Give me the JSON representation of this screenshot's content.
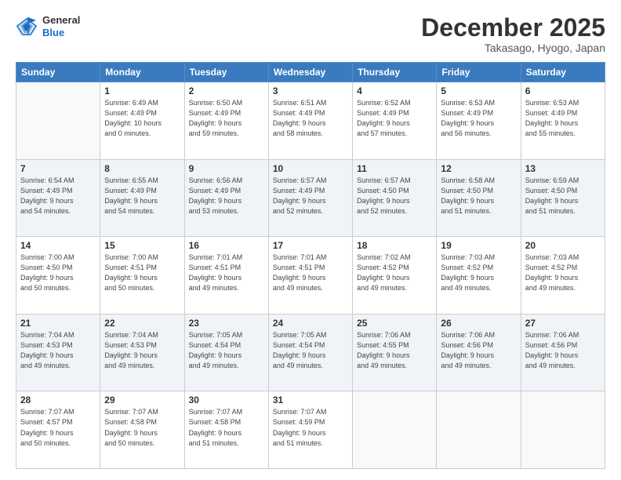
{
  "logo": {
    "line1": "General",
    "line2": "Blue"
  },
  "title": "December 2025",
  "location": "Takasago, Hyogo, Japan",
  "days_header": [
    "Sunday",
    "Monday",
    "Tuesday",
    "Wednesday",
    "Thursday",
    "Friday",
    "Saturday"
  ],
  "weeks": [
    [
      {
        "num": "",
        "info": ""
      },
      {
        "num": "1",
        "info": "Sunrise: 6:49 AM\nSunset: 4:49 PM\nDaylight: 10 hours\nand 0 minutes."
      },
      {
        "num": "2",
        "info": "Sunrise: 6:50 AM\nSunset: 4:49 PM\nDaylight: 9 hours\nand 59 minutes."
      },
      {
        "num": "3",
        "info": "Sunrise: 6:51 AM\nSunset: 4:49 PM\nDaylight: 9 hours\nand 58 minutes."
      },
      {
        "num": "4",
        "info": "Sunrise: 6:52 AM\nSunset: 4:49 PM\nDaylight: 9 hours\nand 57 minutes."
      },
      {
        "num": "5",
        "info": "Sunrise: 6:53 AM\nSunset: 4:49 PM\nDaylight: 9 hours\nand 56 minutes."
      },
      {
        "num": "6",
        "info": "Sunrise: 6:53 AM\nSunset: 4:49 PM\nDaylight: 9 hours\nand 55 minutes."
      }
    ],
    [
      {
        "num": "7",
        "info": "Sunrise: 6:54 AM\nSunset: 4:49 PM\nDaylight: 9 hours\nand 54 minutes."
      },
      {
        "num": "8",
        "info": "Sunrise: 6:55 AM\nSunset: 4:49 PM\nDaylight: 9 hours\nand 54 minutes."
      },
      {
        "num": "9",
        "info": "Sunrise: 6:56 AM\nSunset: 4:49 PM\nDaylight: 9 hours\nand 53 minutes."
      },
      {
        "num": "10",
        "info": "Sunrise: 6:57 AM\nSunset: 4:49 PM\nDaylight: 9 hours\nand 52 minutes."
      },
      {
        "num": "11",
        "info": "Sunrise: 6:57 AM\nSunset: 4:50 PM\nDaylight: 9 hours\nand 52 minutes."
      },
      {
        "num": "12",
        "info": "Sunrise: 6:58 AM\nSunset: 4:50 PM\nDaylight: 9 hours\nand 51 minutes."
      },
      {
        "num": "13",
        "info": "Sunrise: 6:59 AM\nSunset: 4:50 PM\nDaylight: 9 hours\nand 51 minutes."
      }
    ],
    [
      {
        "num": "14",
        "info": "Sunrise: 7:00 AM\nSunset: 4:50 PM\nDaylight: 9 hours\nand 50 minutes."
      },
      {
        "num": "15",
        "info": "Sunrise: 7:00 AM\nSunset: 4:51 PM\nDaylight: 9 hours\nand 50 minutes."
      },
      {
        "num": "16",
        "info": "Sunrise: 7:01 AM\nSunset: 4:51 PM\nDaylight: 9 hours\nand 49 minutes."
      },
      {
        "num": "17",
        "info": "Sunrise: 7:01 AM\nSunset: 4:51 PM\nDaylight: 9 hours\nand 49 minutes."
      },
      {
        "num": "18",
        "info": "Sunrise: 7:02 AM\nSunset: 4:52 PM\nDaylight: 9 hours\nand 49 minutes."
      },
      {
        "num": "19",
        "info": "Sunrise: 7:03 AM\nSunset: 4:52 PM\nDaylight: 9 hours\nand 49 minutes."
      },
      {
        "num": "20",
        "info": "Sunrise: 7:03 AM\nSunset: 4:52 PM\nDaylight: 9 hours\nand 49 minutes."
      }
    ],
    [
      {
        "num": "21",
        "info": "Sunrise: 7:04 AM\nSunset: 4:53 PM\nDaylight: 9 hours\nand 49 minutes."
      },
      {
        "num": "22",
        "info": "Sunrise: 7:04 AM\nSunset: 4:53 PM\nDaylight: 9 hours\nand 49 minutes."
      },
      {
        "num": "23",
        "info": "Sunrise: 7:05 AM\nSunset: 4:54 PM\nDaylight: 9 hours\nand 49 minutes."
      },
      {
        "num": "24",
        "info": "Sunrise: 7:05 AM\nSunset: 4:54 PM\nDaylight: 9 hours\nand 49 minutes."
      },
      {
        "num": "25",
        "info": "Sunrise: 7:06 AM\nSunset: 4:55 PM\nDaylight: 9 hours\nand 49 minutes."
      },
      {
        "num": "26",
        "info": "Sunrise: 7:06 AM\nSunset: 4:56 PM\nDaylight: 9 hours\nand 49 minutes."
      },
      {
        "num": "27",
        "info": "Sunrise: 7:06 AM\nSunset: 4:56 PM\nDaylight: 9 hours\nand 49 minutes."
      }
    ],
    [
      {
        "num": "28",
        "info": "Sunrise: 7:07 AM\nSunset: 4:57 PM\nDaylight: 9 hours\nand 50 minutes."
      },
      {
        "num": "29",
        "info": "Sunrise: 7:07 AM\nSunset: 4:58 PM\nDaylight: 9 hours\nand 50 minutes."
      },
      {
        "num": "30",
        "info": "Sunrise: 7:07 AM\nSunset: 4:58 PM\nDaylight: 9 hours\nand 51 minutes."
      },
      {
        "num": "31",
        "info": "Sunrise: 7:07 AM\nSunset: 4:59 PM\nDaylight: 9 hours\nand 51 minutes."
      },
      {
        "num": "",
        "info": ""
      },
      {
        "num": "",
        "info": ""
      },
      {
        "num": "",
        "info": ""
      }
    ]
  ]
}
